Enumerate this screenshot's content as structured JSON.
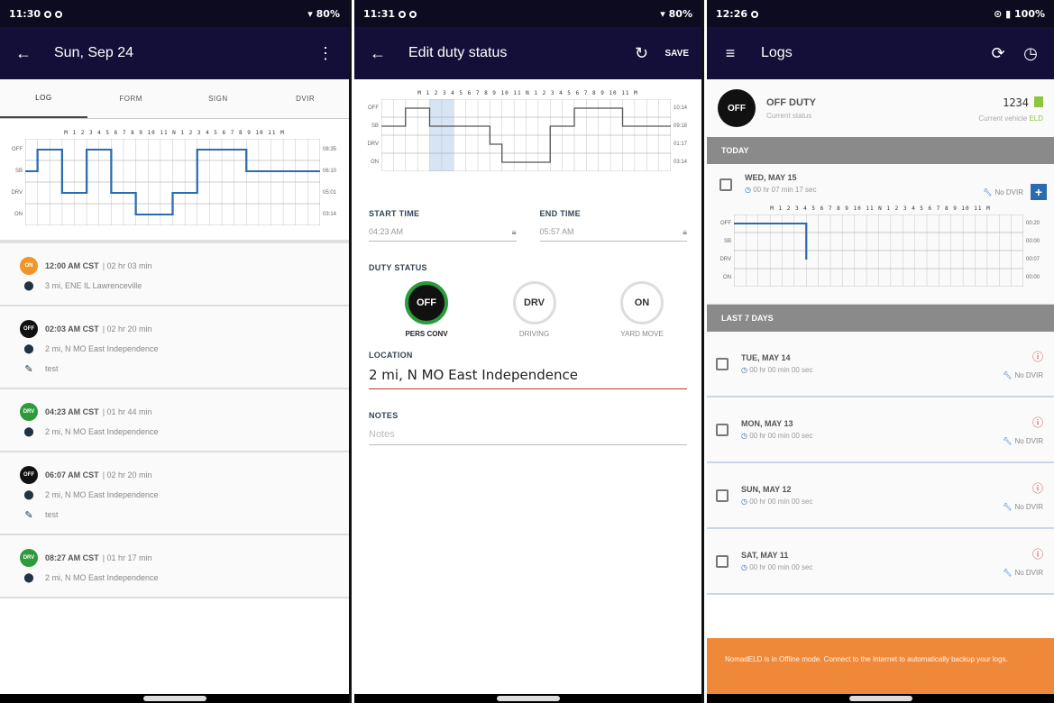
{
  "screen1": {
    "status": {
      "time": "11:30",
      "battery": "80%"
    },
    "title": "Sun, Sep 24",
    "tabs": [
      "LOG",
      "FORM",
      "SIGN",
      "DVIR"
    ],
    "grid": {
      "hours": "M 1 2 3 4 5 6 7 8 9 10 11 N 1 2 3 4 5 6 7 8 9 10 11 M",
      "labels": [
        "OFF",
        "SB",
        "DRV",
        "ON"
      ],
      "totals": [
        "08:35",
        "06:10",
        "05:01",
        "03:14"
      ]
    },
    "events": [
      {
        "badge": "ON",
        "color": "#f0952a",
        "time": "12:00 AM CST",
        "dur": "| 02 hr 03 min",
        "loc": "3 mi, ENE IL Lawrenceville",
        "note": ""
      },
      {
        "badge": "OFF",
        "color": "#111111",
        "time": "02:03 AM CST",
        "dur": "| 02 hr 20 min",
        "loc": "2 mi, N MO East Independence",
        "note": "test"
      },
      {
        "badge": "DRV",
        "color": "#2d9a3b",
        "time": "04:23 AM CST",
        "dur": "| 01 hr 44 min",
        "loc": "2 mi, N MO East Independence",
        "note": ""
      },
      {
        "badge": "OFF",
        "color": "#111111",
        "time": "06:07 AM CST",
        "dur": "| 02 hr 20 min",
        "loc": "2 mi, N MO East Independence",
        "note": "test"
      },
      {
        "badge": "DRV",
        "color": "#2d9a3b",
        "time": "08:27 AM CST",
        "dur": "| 01 hr 17 min",
        "loc": "2 mi, N MO East Independence",
        "note": ""
      }
    ]
  },
  "screen2": {
    "status": {
      "time": "11:31",
      "battery": "80%"
    },
    "title": "Edit duty status",
    "save": "SAVE",
    "grid": {
      "hours": "M 1 2 3 4 5 6 7 8 9 10 11 N 1 2 3 4 5 6 7 8 9 10 11 M",
      "labels": [
        "OFF",
        "SB",
        "DRV",
        "ON"
      ],
      "totals": [
        "10:14",
        "09:18",
        "01:17",
        "03:14"
      ]
    },
    "start_label": "START TIME",
    "start_value": "04:23 AM",
    "end_label": "END TIME",
    "end_value": "05:57 AM",
    "duty_label": "DUTY STATUS",
    "options": [
      {
        "code": "OFF",
        "caption": "PERS CONV"
      },
      {
        "code": "DRV",
        "caption": "DRIVING"
      },
      {
        "code": "ON",
        "caption": "YARD MOVE"
      }
    ],
    "location_label": "LOCATION",
    "location_value": "2 mi, N MO East Independence",
    "notes_label": "NOTES",
    "notes_placeholder": "Notes"
  },
  "screen3": {
    "status": {
      "time": "12:26",
      "battery": "100%"
    },
    "title": "Logs",
    "current": {
      "code": "OFF",
      "status": "OFF DUTY",
      "status_caption": "Current status",
      "vehicle": "1234",
      "vehicle_caption": "Current vehicle",
      "eld": "ELD"
    },
    "today_label": "TODAY",
    "today": {
      "date": "WED, MAY 15",
      "duration": "00 hr 07 min 17 sec",
      "dvir": "No DVIR"
    },
    "grid": {
      "hours": "M 1 2 3 4 5 6 7 8 9 10 11 N 1 2 3 4 5 6 7 8 9 10 11 M",
      "labels": [
        "OFF",
        "SB",
        "DRV",
        "ON"
      ],
      "totals": [
        "00:20",
        "00:00",
        "00:07",
        "00:00"
      ]
    },
    "last7_label": "LAST 7 DAYS",
    "days": [
      {
        "date": "TUE, MAY 14",
        "duration": "00 hr 00 min 00 sec",
        "dvir": "No DVIR"
      },
      {
        "date": "MON, MAY 13",
        "duration": "00 hr 00 min 00 sec",
        "dvir": "No DVIR"
      },
      {
        "date": "SUN, MAY 12",
        "duration": "00 hr 00 min 00 sec",
        "dvir": "No DVIR"
      },
      {
        "date": "SAT, MAY 11",
        "duration": "00 hr 00 min 00 sec",
        "dvir": "No DVIR"
      }
    ],
    "banner": "NomadELD is in Offline mode. Connect to the Internet to automatically backup your logs."
  },
  "colors": {
    "appbar": "#140f38",
    "status": "#0c0b20",
    "line": "#2b6cb0",
    "accent_green": "#2d9a3b",
    "banner": "#f0883a"
  }
}
